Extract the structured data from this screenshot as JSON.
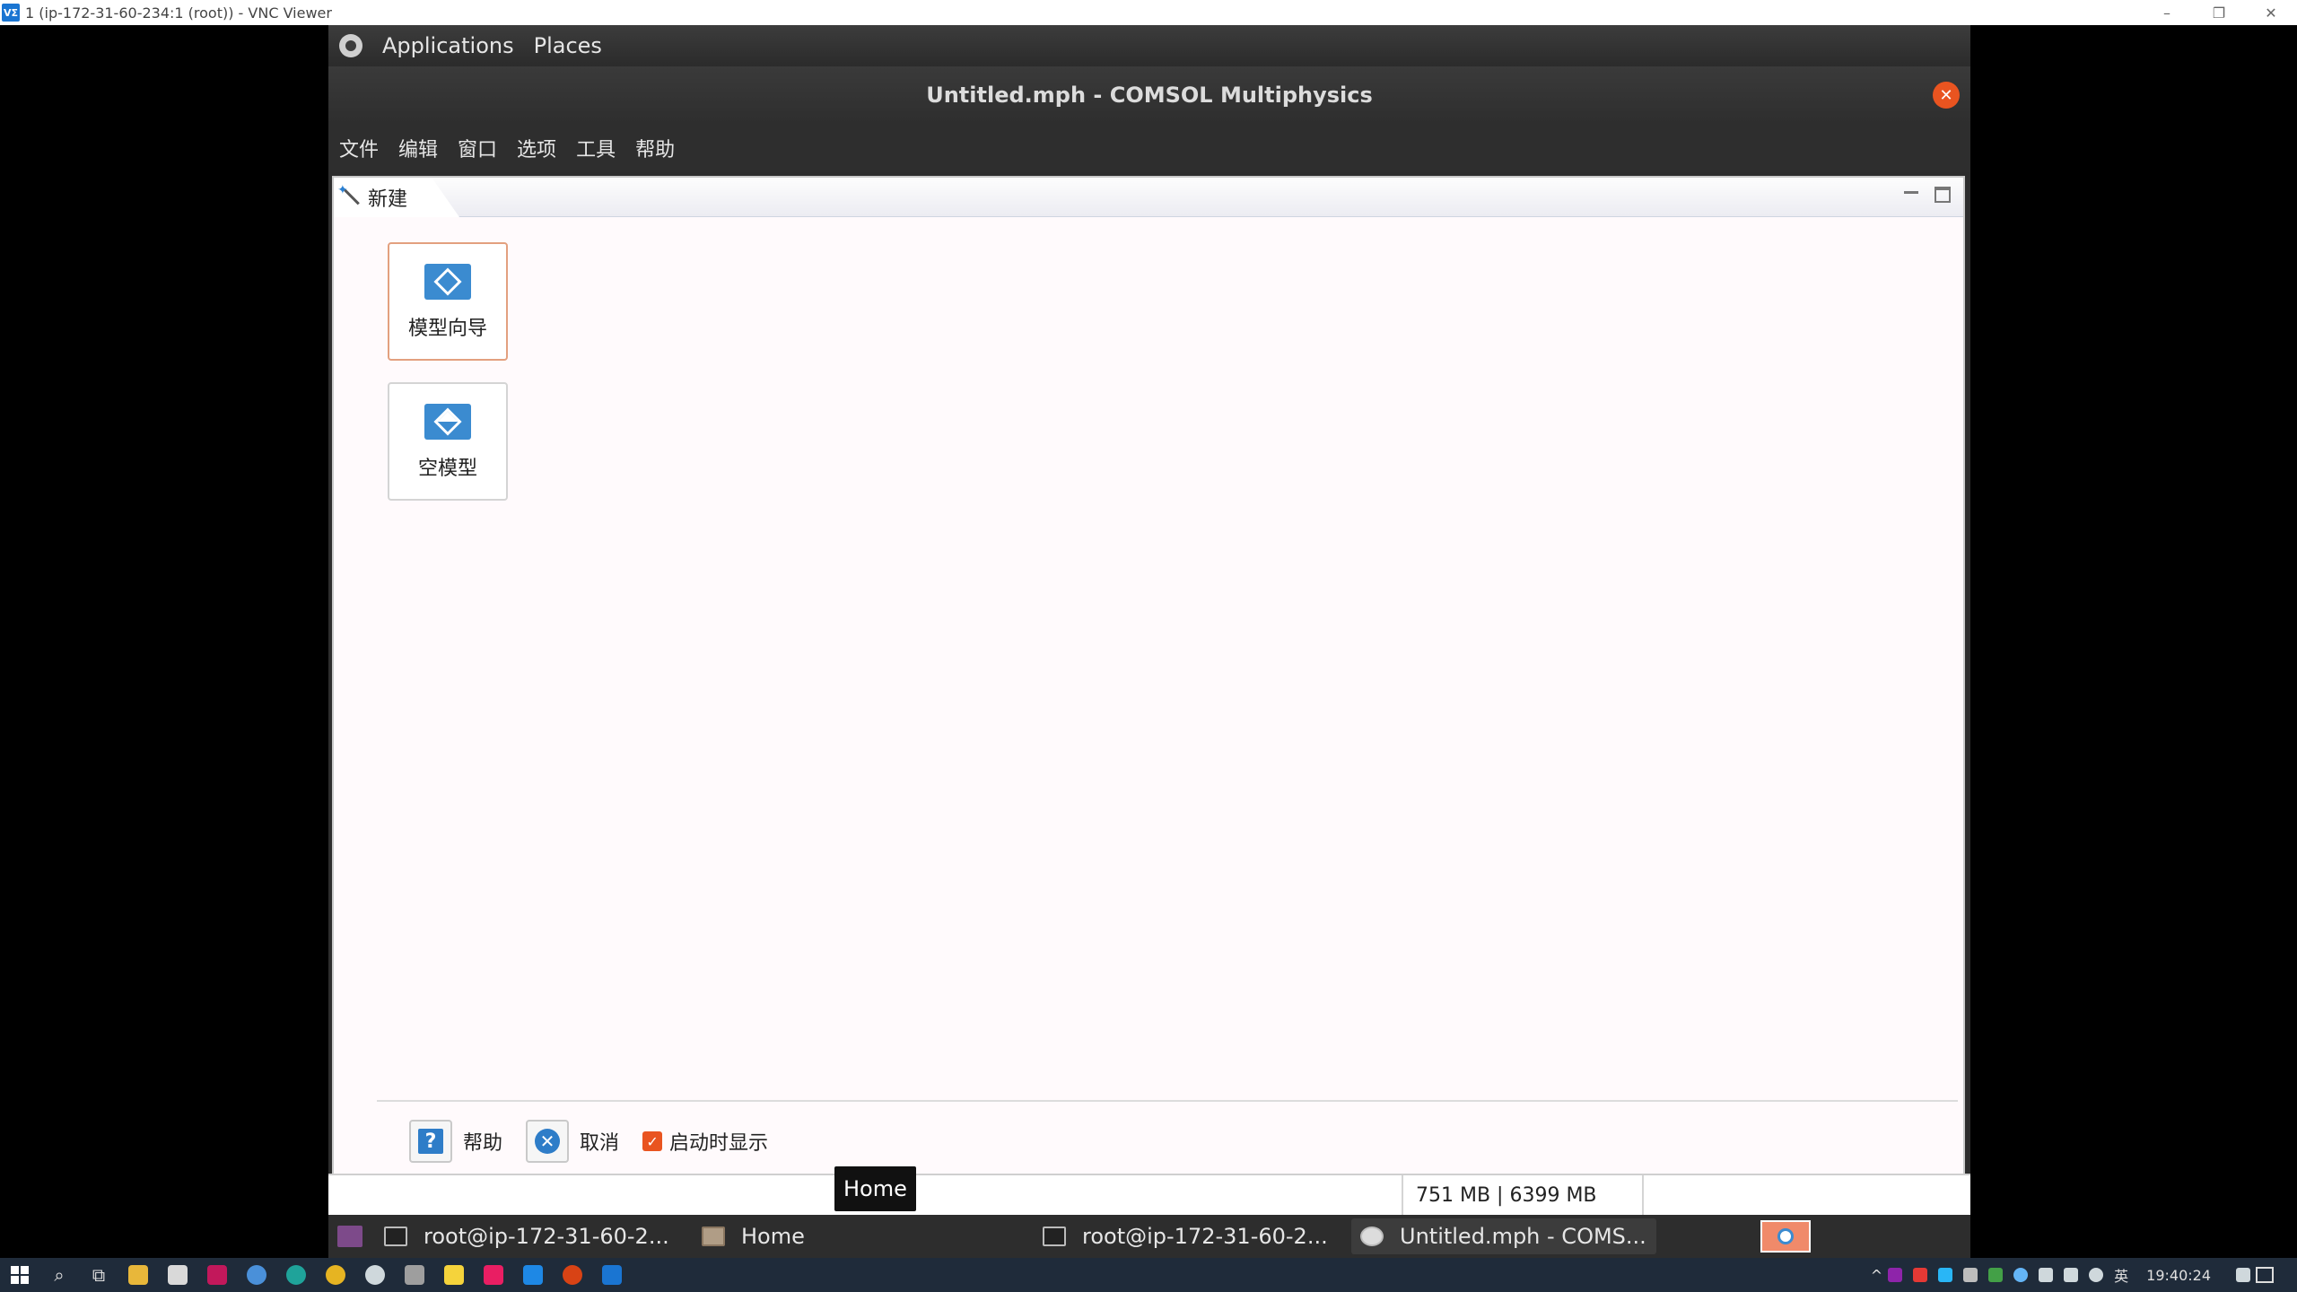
{
  "vnc": {
    "logo": "VΣ",
    "title": "1 (ip-172-31-60-234:1 (root)) - VNC Viewer",
    "controls": [
      "–",
      "❐",
      "✕"
    ]
  },
  "gnome_panel": {
    "applications": "Applications",
    "places": "Places"
  },
  "window": {
    "title": "Untitled.mph - COMSOL Multiphysics",
    "close": "✕"
  },
  "menubar": {
    "items": [
      "文件",
      "编辑",
      "窗口",
      "选项",
      "工具",
      "帮助"
    ]
  },
  "tab": {
    "label": "新建"
  },
  "cards": {
    "wizard": "模型向导",
    "blank": "空模型"
  },
  "footer": {
    "help_glyph": "?",
    "help": "帮助",
    "cancel_glyph": "✕",
    "cancel": "取消",
    "check_glyph": "✓",
    "show_on_startup": "启动时显示",
    "show_on_startup_checked": true
  },
  "statusbar": {
    "memory": "751 MB | 6399 MB"
  },
  "tooltip": {
    "text": "Home"
  },
  "gnome_taskbar": {
    "tasks": [
      "root@ip-172-31-60-2...",
      "Home",
      "root@ip-172-31-60-2...",
      "Untitled.mph - COMS..."
    ]
  },
  "win_taskbar": {
    "lang": "英",
    "clock": "19:40:24"
  },
  "colors": {
    "accent": "#e95420",
    "comsol_blue": "#3b8bd0"
  }
}
